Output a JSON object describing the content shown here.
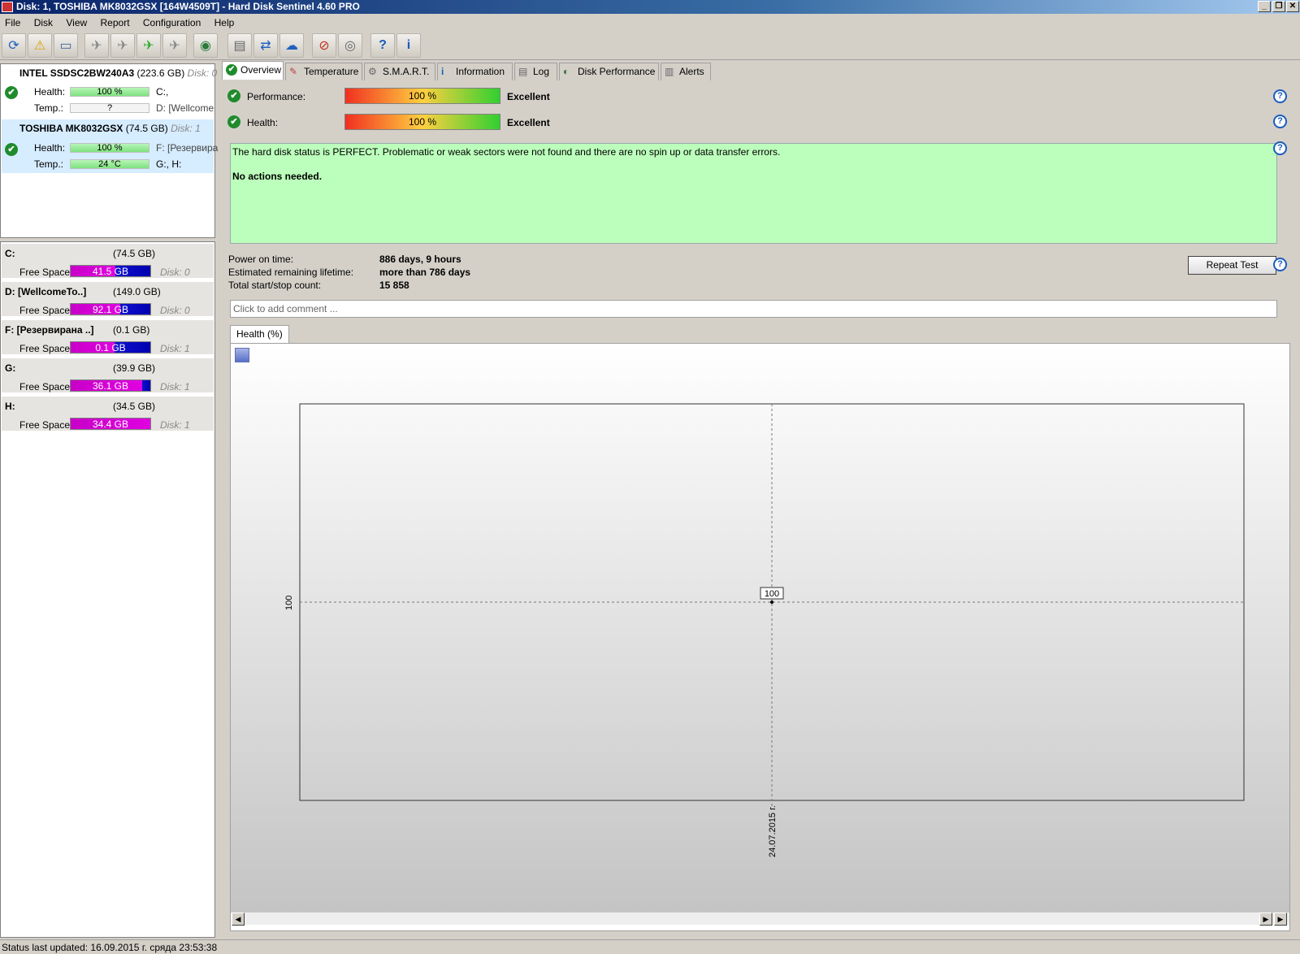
{
  "window": {
    "title": "Disk: 1, TOSHIBA MK8032GSX [164W4509T]  -  Hard Disk Sentinel 4.60 PRO"
  },
  "menu": {
    "items": [
      "File",
      "Disk",
      "View",
      "Report",
      "Configuration",
      "Help"
    ]
  },
  "toolbar": {
    "icons": [
      "refresh-icon",
      "warning-icon",
      "disk-icon",
      "satellite-dish-icon",
      "satellite-dish-icon",
      "satellite-ok-icon",
      "satellite-icon",
      "globe-icon",
      "document-icon",
      "sync-icon",
      "network-icon",
      "no-screen-icon",
      "sound-icon",
      "help-icon",
      "info-icon"
    ]
  },
  "disks": [
    {
      "name": "INTEL SSDSC2BW240A3",
      "size": "(223.6 GB)",
      "disk": "Disk: 0",
      "health_label": "Health:",
      "health": "100 %",
      "health_level": 100,
      "temp_label": "Temp.:",
      "temp": "?",
      "drives1": "C:,",
      "drives2": "D: [Wellcome"
    },
    {
      "name": "TOSHIBA MK8032GSX",
      "size": "(74.5 GB)",
      "disk": "Disk: 1",
      "health_label": "Health:",
      "health": "100 %",
      "health_level": 100,
      "temp_label": "Temp.:",
      "temp": "24 °C",
      "drives1": "F: [Резервира",
      "drives2": "G:, H:"
    }
  ],
  "partitions": [
    {
      "name": "C:",
      "size": "(74.5 GB)",
      "free_label": "Free Space",
      "free": "41.5 GB",
      "disk": "Disk: 0",
      "free_fraction": 0.56
    },
    {
      "name": "D: [WellcomeTo..]",
      "size": "(149.0 GB)",
      "free_label": "Free Space",
      "free": "92.1 GB",
      "disk": "Disk: 0",
      "free_fraction": 0.62
    },
    {
      "name": "F: [Резервирана ..]",
      "size": "(0.1 GB)",
      "free_label": "Free Space",
      "free": "0.1 GB",
      "disk": "Disk: 1",
      "free_fraction": 0.55
    },
    {
      "name": "G:",
      "size": "(39.9 GB)",
      "free_label": "Free Space",
      "free": "36.1 GB",
      "disk": "Disk: 1",
      "free_fraction": 0.9
    },
    {
      "name": "H:",
      "size": "(34.5 GB)",
      "free_label": "Free Space",
      "free": "34.4 GB",
      "disk": "Disk: 1",
      "free_fraction": 1.0
    }
  ],
  "tabs": [
    "Overview",
    "Temperature",
    "S.M.A.R.T.",
    "Information",
    "Log",
    "Disk Performance",
    "Alerts"
  ],
  "overview": {
    "performance_label": "Performance:",
    "performance_value": "100 %",
    "performance_rating": "Excellent",
    "health_label": "Health:",
    "health_value": "100 %",
    "health_rating": "Excellent",
    "status_line1": "The hard disk status is PERFECT. Problematic or weak sectors were not found and there are no spin up or data transfer errors.",
    "status_line2": "No actions needed.",
    "power_on_label": "Power on time:",
    "power_on_value": "886 days, 9 hours",
    "lifetime_label": "Estimated remaining lifetime:",
    "lifetime_value": "more than 786 days",
    "startstop_label": "Total start/stop count:",
    "startstop_value": "15 858",
    "repeat_test": "Repeat Test",
    "comment_placeholder": "Click to add comment ...",
    "chart_tab": "Health (%)"
  },
  "chart_data": {
    "type": "line",
    "title": "",
    "x": [
      "24.07.2015 г."
    ],
    "series": [
      {
        "values": [
          100
        ]
      }
    ],
    "data_labels": [
      "100"
    ],
    "ytick_labels": [
      "100"
    ],
    "xlabel": "",
    "ylabel": ""
  },
  "status_bar": {
    "text": "Status last updated: 16.09.2015 г. сряда 23:53:38"
  }
}
